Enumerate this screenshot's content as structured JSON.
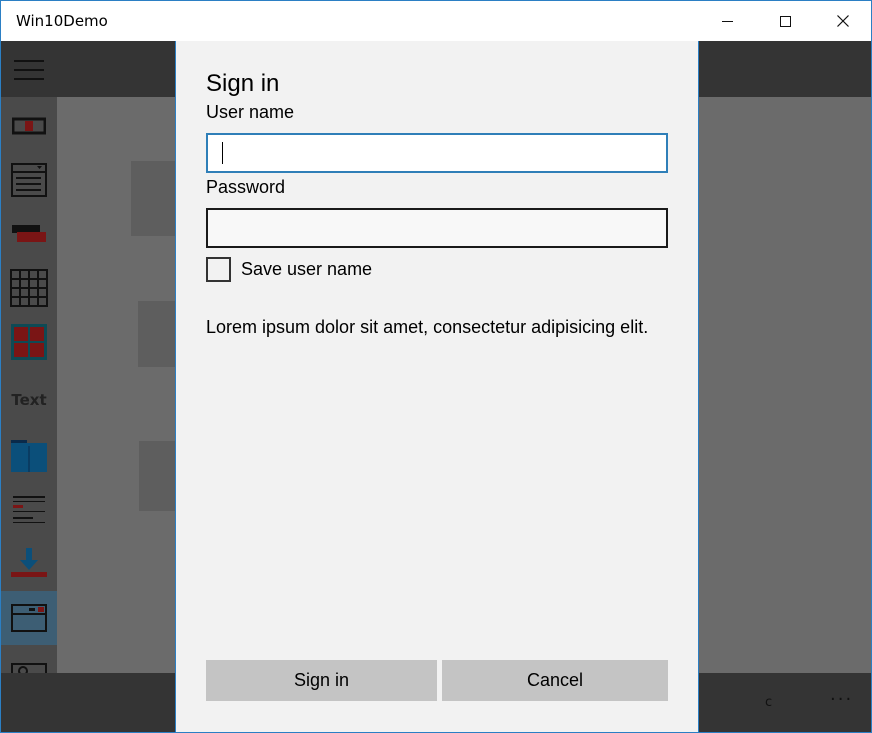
{
  "window": {
    "title": "Win10Demo"
  },
  "rail": {
    "text_item_label": "Text"
  },
  "bottombar": {
    "label": "c",
    "more": "···"
  },
  "dialog": {
    "title": "Sign in",
    "username_label": "User name",
    "username_value": "",
    "password_label": "Password",
    "password_value": "",
    "save_username_label": "Save user name",
    "save_username_checked": false,
    "body_text": "Lorem ipsum dolor sit amet, consectetur adipisicing elit.",
    "primary_button": "Sign in",
    "secondary_button": "Cancel"
  },
  "colors": {
    "accent": "#2f7fb8",
    "button_bg": "#c4c4c4",
    "dialog_bg": "#f2f2f2",
    "overlay": "#6b6b6b"
  },
  "icons": {
    "close": "close-icon",
    "maximize": "maximize-icon",
    "minimize": "minimize-icon",
    "menu": "hamburger-icon"
  }
}
